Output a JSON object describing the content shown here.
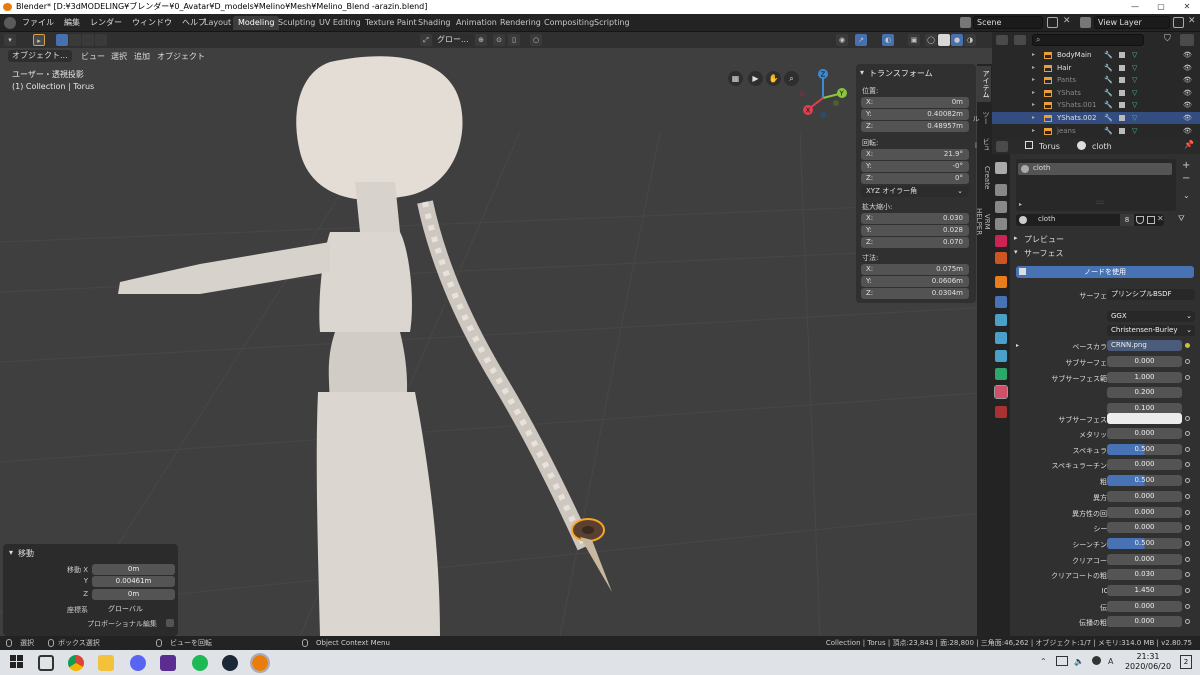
{
  "window": {
    "title": "Blender* [D:¥3dMODELING¥ブレンダー¥0_Avatar¥D_models¥Melino¥Mesh¥Melino_Blend -arazin.blend]"
  },
  "menu": [
    "ファイル",
    "編集",
    "レンダー",
    "ウィンドウ",
    "ヘルプ"
  ],
  "workspaces": [
    "Layout",
    "Modeling",
    "Sculpting",
    "UV Editing",
    "Texture Paint",
    "Shading",
    "Animation",
    "Rendering",
    "Compositing",
    "Scripting"
  ],
  "workspace_active": "Modeling",
  "scene": {
    "label": "Scene",
    "view_layer": "View Layer"
  },
  "viewport": {
    "mode": "オブジェクト...",
    "menus": [
      "ビュー",
      "選択",
      "追加",
      "オブジェクト"
    ],
    "orientation": "グロー...",
    "info_line1": "ユーザー・透視投影",
    "info_line2": "(1) Collection | Torus"
  },
  "gizmo": {
    "x": "X",
    "y": "Y",
    "z": "Z"
  },
  "npanel": {
    "title": "トランスフォーム",
    "location_label": "位置:",
    "location": {
      "x": "0m",
      "y": "0.40082m",
      "z": "0.48957m"
    },
    "rotation_label": "回転:",
    "rotation": {
      "x": "21.9°",
      "y": "-0°",
      "z": "0°"
    },
    "rotation_mode": "XYZ オイラー角",
    "scale_label": "拡大縮小:",
    "scale": {
      "x": "0.030",
      "y": "0.028",
      "z": "0.070"
    },
    "dimensions_label": "寸法:",
    "dimensions": {
      "x": "0.075m",
      "y": "0.0606m",
      "z": "0.0304m"
    },
    "axis": {
      "x": "X:",
      "y": "Y:",
      "z": "Z:"
    }
  },
  "vtabs": [
    "アイテム",
    "ツール",
    "ビュー",
    "Create",
    "VRM HELPER"
  ],
  "move_panel": {
    "title": "移動",
    "label_x": "移動 X",
    "label_y": "Y",
    "label_z": "Z",
    "x": "0m",
    "y": "0.00461m",
    "z": "0m",
    "orient_label": "座標系",
    "orient_value": "グローバル",
    "prop_label": "プロポーショナル編集"
  },
  "outliner": {
    "items": [
      "BodyMain",
      "Hair",
      "Pants",
      "YShats",
      "YShats.001",
      "YShats.002",
      "jeans"
    ],
    "selected": "YShats.002"
  },
  "properties": {
    "object": "Torus",
    "material": "cloth",
    "slot": "cloth",
    "material_name": "cloth",
    "users": "8",
    "preview_label": "プレビュー",
    "surface_section": "サーフェス",
    "use_nodes": "ノードを使用",
    "surface_label": "サーフェス",
    "surface_value": "プリンシプルBSDF",
    "distribution": "GGX",
    "subsurface_method": "Christensen-Burley",
    "base_color_label": "ベースカラー",
    "base_color_value": "CRNN.png",
    "rows": [
      {
        "label": "サブサーフェス",
        "value": "0.000",
        "blue": false
      },
      {
        "label": "サブサーフェス範囲",
        "value": "1.000",
        "blue": false
      },
      {
        "label": "",
        "value": "0.200",
        "blue": false
      },
      {
        "label": "",
        "value": "0.100",
        "blue": false
      }
    ],
    "subsurface_color_label": "サブサーフェス色",
    "rows2": [
      {
        "label": "メタリック",
        "value": "0.000",
        "blue": false
      },
      {
        "label": "スペキュラー",
        "value": "0.500",
        "blue": true
      },
      {
        "label": "スペキュラーチント",
        "value": "0.000",
        "blue": false
      },
      {
        "label": "粗さ",
        "value": "0.500",
        "blue": true
      },
      {
        "label": "異方性",
        "value": "0.000",
        "blue": false
      },
      {
        "label": "異方性の回転",
        "value": "0.000",
        "blue": false
      },
      {
        "label": "シーン",
        "value": "0.000",
        "blue": false
      },
      {
        "label": "シーンチント",
        "value": "0.500",
        "blue": true
      },
      {
        "label": "クリアコート",
        "value": "0.000",
        "blue": false
      },
      {
        "label": "クリアコートの粗さ",
        "value": "0.030",
        "blue": false
      },
      {
        "label": "IOR",
        "value": "1.450",
        "blue": false
      },
      {
        "label": "伝播",
        "value": "0.000",
        "blue": false
      },
      {
        "label": "伝播の粗さ",
        "value": "0.000",
        "blue": false
      }
    ]
  },
  "statusbar": {
    "select": "選択",
    "box_select": "ボックス選択",
    "rotate_view": "ビューを回転",
    "context_menu": "Object Context Menu",
    "stats": "Collection | Torus | 頂点:23,843 | 面:28,800 | 三角面:46,262 | オブジェクト:1/7 | メモリ:314.0 MB | v2.80.75"
  },
  "taskbar": {
    "time": "21:31",
    "date": "2020/06/20",
    "notifications": "2"
  },
  "colors": {
    "accent": "#4772b3",
    "selection_orange": "#f5a623",
    "outliner_selected": "#334d80"
  }
}
